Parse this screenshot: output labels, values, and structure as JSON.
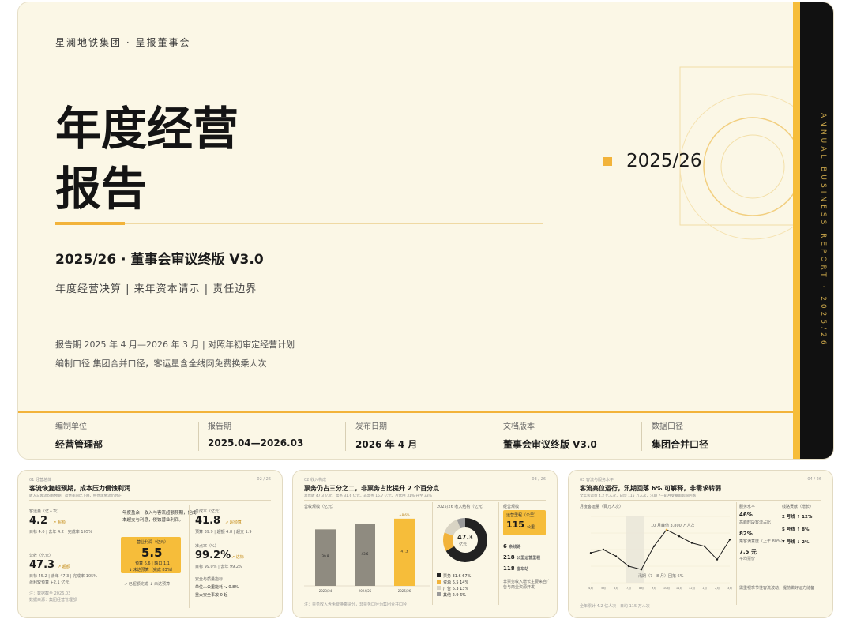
{
  "cover": {
    "org": "星澜地铁集团  ·  呈报董事会",
    "title_line1": "年度经营",
    "title_line2": "报告",
    "year": "2025/26",
    "subtitle": "2025/26 · 董事会审议终版 V3.0",
    "tagline": "年度经营决算 | 来年资本请示 | 责任边界",
    "meta_period": "报告期 2025 年 4 月—2026 年 3 月 | 对照年初审定经营计划",
    "meta_scope": "编制口径 集团合并口径，客运量含全线网免费换乘人次",
    "spine": "ANNUAL BUSINESS REPORT · 2025/26",
    "footer": [
      {
        "label": "编制单位",
        "value": "经营管理部"
      },
      {
        "label": "报告期",
        "value": "2025.04—2026.03"
      },
      {
        "label": "发布日期",
        "value": "2026 年 4 月"
      },
      {
        "label": "文档版本",
        "value": "董事会审议终版 V3.0"
      },
      {
        "label": "数据口径",
        "value": "集团合并口径"
      }
    ],
    "colors": {
      "accent": "#f2b33a",
      "spine": "#111111",
      "paper": "#fbf7e6"
    }
  },
  "card1": {
    "crumb": "01  经营总体",
    "page": "02 / 26",
    "title": "客流恢复超预期，成本压力侵蚀利润",
    "sub": "收入与客流均超预期，盈余率同比下降，经营现金流仍为正",
    "k1_label": "客运量（亿人次）",
    "k1_value": "4.2",
    "k1_note": "↗ 超额",
    "k1_detail": "目标 4.0 | 去年 4.2 | 完成率 105%",
    "k2_label": "营收（亿元）",
    "k2_value": "47.3",
    "k2_note": "↗ 超额",
    "k2_detail": "目标 45.2 | 去年 47.3 | 完成率 105%",
    "k2_extra": "盈利较预算 +2.1 亿元",
    "mid_text": "年度盈余：收入与客流超额预期，但成本超支与利息，侵蚀营业利润。",
    "mid_box_label": "营业利润（亿元）",
    "mid_box_value": "5.5",
    "mid_box_note": "预算 6.6 | 缺口 1.1",
    "mid_box_tag": "↓ 未达预算（完成 83%）",
    "mid_foot": "↗ 已超额完成  ↓ 未达预算",
    "k3_label": "总成本（亿元）",
    "k3_value": "41.8",
    "k3_note": "↗ 超预算",
    "k3_detail": "预算 39.9 | 超额 4.8 | 超支 1.9",
    "k4_label": "准点率（%）",
    "k4_value": "99.2%",
    "k4_note": "↗ 达标",
    "k4_detail": "目标 99.0% | 去年 99.2%",
    "k5_label": "安全与质量指标",
    "k5_line1": "单位人公里能耗 ↘ 0.8%",
    "k5_line2": "重大安全事故 0 起",
    "foot1": "注：数据截至 2026.03",
    "foot2": "数据来源：集团经营管理部"
  },
  "card2": {
    "crumb": "02  收入构成",
    "page": "03 / 26",
    "title": "票务仍占三分之二，非票务占比提升 2 个百分点",
    "sub": "总营收 47.3 亿元，票务 31.6 亿元，非票务 15.7 亿元，占比由 31% 升至 33%",
    "left_label": "营收规模（亿元）",
    "bar_badge": "+8.6%",
    "bars": [
      {
        "label": "2023/24",
        "value": 39.8
      },
      {
        "label": "2024/25",
        "value": 43.6
      },
      {
        "label": "2025/26",
        "value": 47.3
      }
    ],
    "donut_label": "2025/26 收入结构（亿元）",
    "donut_value": "47.3",
    "donut_unit": "亿元",
    "segments": [
      {
        "name": "票务",
        "value": 31.6,
        "pct": "67%",
        "color": "#222222"
      },
      {
        "name": "资源",
        "value": 6.5,
        "pct": "14%",
        "color": "#f2b33a"
      },
      {
        "name": "广告",
        "value": 6.3,
        "pct": "13%",
        "color": "#d9d4c4"
      },
      {
        "name": "其他",
        "value": 2.9,
        "pct": "6%",
        "color": "#9a9a9a"
      }
    ],
    "right_label": "经营规模",
    "right_box_label": "运营里程（公里）",
    "right_box_value": "115",
    "right_box_unit": "公里",
    "stat1_value": "6",
    "stat1_label": "条线路",
    "stat2_value": "218",
    "stat2_label": "公里运营里程",
    "stat3_value": "118",
    "stat3_label": "座车站",
    "right_note": "非票务收入增长主要来自广告与商业资源开发",
    "foot": "注：票务收入含免费换乘清分，非票务口径为集团合并口径"
  },
  "card3": {
    "crumb": "03  客流与服务水平",
    "page": "04 / 26",
    "title": "客流高位运行，汛期回落 6% 可解释，非需求转弱",
    "sub": "全年客运量 4.2 亿人次，日均 115 万人次，汛期 7—8 月受暴雨影响回落",
    "chart_label": "月度客运量（百万人次）",
    "peak_label": "10 月峰值 3,800 万人次",
    "trough_label": "汛期（7—8 月）回落 6%",
    "months": [
      "4月",
      "5月",
      "6月",
      "7月",
      "8月",
      "9月",
      "10月",
      "11月",
      "12月",
      "1月",
      "2月",
      "3月"
    ],
    "right_label": "服务水平",
    "r1_value": "46%",
    "r1_label": "高峰时段客流占比",
    "r2_value": "82%",
    "r2_label": "乘客满意度（上年 80%）",
    "r3_value": "7.5 元",
    "r3_label": "平均票价",
    "lines_label": "线路贡献（增长）",
    "line1": "2 号线 ↑ 12%",
    "line2": "5 号线 ↑ 8%",
    "line3": "7 号线 ↓ 2%",
    "note": "需重视季节性客流波动，提前做好运力储备",
    "foot": "全年累计 4.2 亿人次 | 日均 115 万人次"
  }
}
